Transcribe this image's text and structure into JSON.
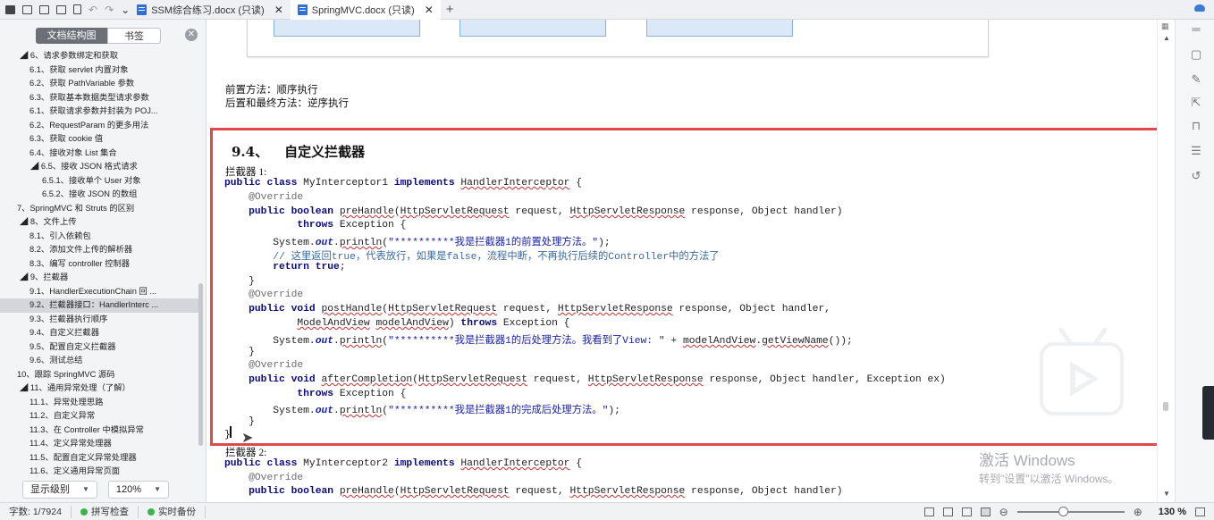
{
  "tabs": [
    {
      "label": "SSM综合练习.docx (只读)",
      "close": "✕"
    },
    {
      "label": "SpringMVC.docx (只读)",
      "close": "✕"
    }
  ],
  "new_tab": "+",
  "left_panel": {
    "toggle": {
      "outline_label": "文档结构图",
      "bookmark_label": "书签"
    },
    "close": "✕",
    "outline": [
      {
        "text": "◢ 6、请求参数绑定和获取",
        "indent": 0
      },
      {
        "text": "6.1、获取 servlet 内置对象",
        "indent": 1
      },
      {
        "text": "6.2、获取 PathVariable 参数",
        "indent": 1
      },
      {
        "text": "6.3、获取基本数据类型请求参数",
        "indent": 1
      },
      {
        "text": "6.1、获取请求参数并封装为 POJ...",
        "indent": 1
      },
      {
        "text": "6.2、RequestParam 的更多用法",
        "indent": 1
      },
      {
        "text": "6.3、获取 cookie 值",
        "indent": 1
      },
      {
        "text": "6.4、接收对象 List 集合",
        "indent": 1
      },
      {
        "text": "◢ 6.5、接收 JSON 格式请求",
        "indent": 1
      },
      {
        "text": "6.5.1、接收单个 User 对象",
        "indent": 2
      },
      {
        "text": "6.5.2、接收 JSON 的数组",
        "indent": 2
      },
      {
        "text": "7、SpringMVC 和 Struts 的区别",
        "indent": 0
      },
      {
        "text": "◢ 8、文件上传",
        "indent": 0
      },
      {
        "text": "8.1、引入依赖包",
        "indent": 1
      },
      {
        "text": "8.2、添加文件上传的解析器",
        "indent": 1
      },
      {
        "text": "8.3、编写 controller 控制器",
        "indent": 1
      },
      {
        "text": "◢ 9、拦截器",
        "indent": 0
      },
      {
        "text": "9.1、HandlerExecutionChain 回 ...",
        "indent": 1
      },
      {
        "text": "9.2、拦截器接口：HandlerInterc ...",
        "indent": 1,
        "selected": true
      },
      {
        "text": "9.3、拦截器执行顺序",
        "indent": 1
      },
      {
        "text": "9.4、自定义拦截器",
        "indent": 1
      },
      {
        "text": "9.5、配置自定义拦截器",
        "indent": 1
      },
      {
        "text": "9.6、测试总结",
        "indent": 1
      },
      {
        "text": "10、跟踪 SpringMVC 源码",
        "indent": 0
      },
      {
        "text": "◢ 11、通用异常处理（了解）",
        "indent": 0
      },
      {
        "text": "11.1、异常处理思路",
        "indent": 1
      },
      {
        "text": "11.2、自定义异常",
        "indent": 1
      },
      {
        "text": "11.3、在 Controller 中模拟异常",
        "indent": 1
      },
      {
        "text": "11.4、定义异常处理器",
        "indent": 1
      },
      {
        "text": "11.5、配置自定义异常处理器",
        "indent": 1
      },
      {
        "text": "11.6、定义通用异常页面",
        "indent": 1
      }
    ],
    "level_dropdown": "显示级别",
    "zoom_dropdown": "120%"
  },
  "document": {
    "line_pre": "前置方法：顺序执行",
    "line_post": "后置和最终方法：逆序执行",
    "heading_num": "9.4、",
    "heading_text": "自定义拦截器",
    "interceptor1_label": "拦截器 1:",
    "interceptor2_label": "拦截器 2:"
  },
  "watermark": {
    "line1": "激活 Windows",
    "line2": "转到\"设置\"以激活 Windows。"
  },
  "status": {
    "word_count": "字数: 1/7924",
    "spell_check": "拼写检查",
    "backup": "实时备份",
    "zoom": "130 %",
    "zoom_minus": "⊖",
    "zoom_plus": "⊕"
  }
}
